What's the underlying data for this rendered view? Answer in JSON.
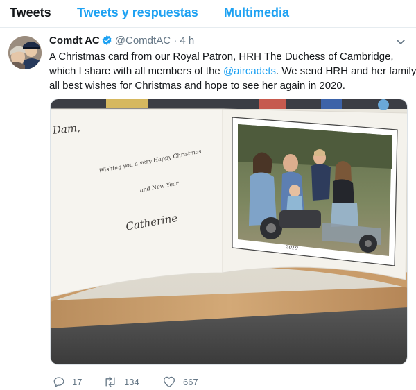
{
  "tabs": [
    {
      "label": "Tweets",
      "active": true
    },
    {
      "label": "Tweets y respuestas",
      "active": false
    },
    {
      "label": "Multimedia",
      "active": false
    }
  ],
  "tweet": {
    "author_name": "Comdt AC",
    "handle": "@ComdtAC",
    "separator": "·",
    "time": "4 h",
    "verified": true,
    "text_line1": "A Christmas card from our Royal Patron, HRH The Duchess of Cambridge,",
    "text_line2_before": "which I share with all members of the ",
    "mention": "@aircadets",
    "text_line2_after": ".  We send HRH and her family",
    "text_line3": "all best wishes for Christmas and hope to see her again in 2020.",
    "card": {
      "salutation": "Dam,",
      "greeting_line1": "Wishing you a very Happy Christmas",
      "greeting_line2": "and New Year",
      "signature": "Catherine",
      "year": "2019"
    },
    "stats": {
      "replies": "17",
      "retweets": "134",
      "likes": "667"
    }
  },
  "colors": {
    "accent": "#1da1f2",
    "text": "#14171a",
    "muted": "#657786",
    "border": "#e6ecf0"
  }
}
